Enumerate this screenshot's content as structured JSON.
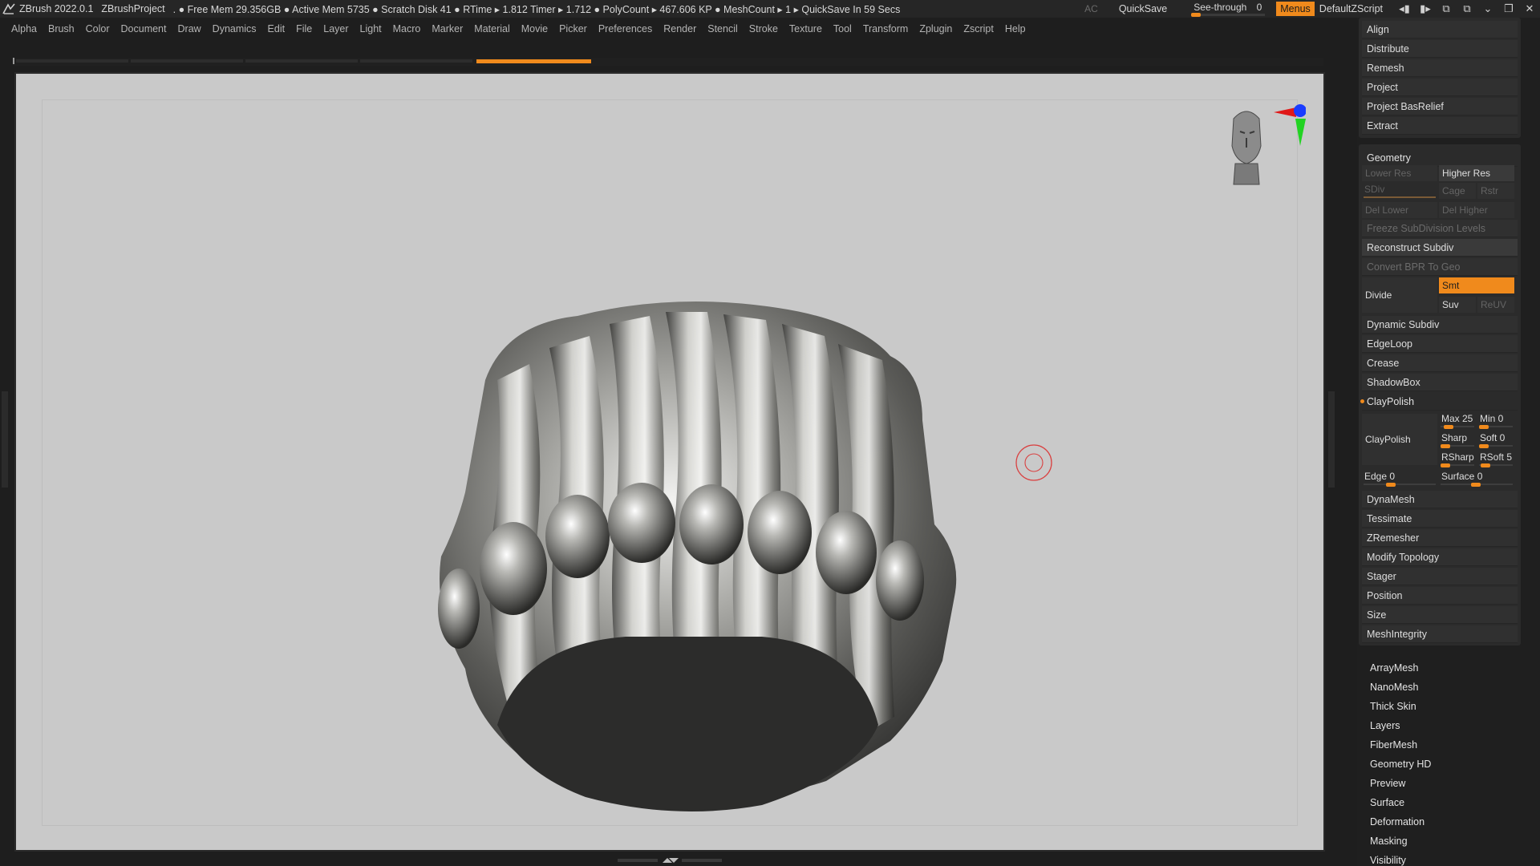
{
  "titlebar": {
    "app": "ZBrush 2022.0.1",
    "project": "ZBrushProject",
    "stats": ". ● Free Mem 29.356GB ● Active Mem 5735 ● Scratch Disk 41 ● RTime ▸ 1.812 Timer ▸ 1.712 ● PolyCount ▸ 467.606 KP ● MeshCount ▸ 1 ▸ QuickSave In 59 Secs",
    "ac": "AC",
    "quicksave": "QuickSave",
    "seethrough_label": "See-through",
    "seethrough_value": "0",
    "menus": "Menus",
    "script": "DefaultZScript"
  },
  "menubar": [
    "Alpha",
    "Brush",
    "Color",
    "Document",
    "Draw",
    "Dynamics",
    "Edit",
    "File",
    "Layer",
    "Light",
    "Macro",
    "Marker",
    "Material",
    "Movie",
    "Picker",
    "Preferences",
    "Render",
    "Stencil",
    "Stroke",
    "Texture",
    "Tool",
    "Transform",
    "Zplugin",
    "Zscript",
    "Help"
  ],
  "palette": {
    "top_items": [
      "Align",
      "Distribute",
      "Remesh",
      "Project",
      "Project BasRelief",
      "Extract"
    ],
    "geometry": {
      "title": "Geometry",
      "lower_res": "Lower Res",
      "higher_res": "Higher Res",
      "sdiv": "SDiv",
      "cage": "Cage",
      "rstr": "Rstr",
      "del_lower": "Del Lower",
      "del_higher": "Del Higher",
      "freeze": "Freeze SubDivision Levels",
      "reconstruct": "Reconstruct Subdiv",
      "convert_bpr": "Convert BPR To Geo",
      "divide": "Divide",
      "smt": "Smt",
      "suv": "Suv",
      "reuv": "ReUV",
      "dynamic_subdiv": "Dynamic Subdiv",
      "edgeloop": "EdgeLoop",
      "crease": "Crease",
      "shadowbox": "ShadowBox",
      "claypolish_header": "ClayPolish",
      "claypolish_btn": "ClayPolish",
      "max": "Max 25",
      "min": "Min 0",
      "sharp": "Sharp",
      "soft": "Soft 0",
      "rsharp": "RSharp",
      "rsoft": "RSoft 5",
      "edge": "Edge 0",
      "surface": "Surface 0",
      "after": [
        "DynaMesh",
        "Tessimate",
        "ZRemesher",
        "Modify Topology",
        "Stager",
        "Position",
        "Size",
        "MeshIntegrity"
      ]
    },
    "subpalettes": [
      "ArrayMesh",
      "NanoMesh",
      "Thick Skin",
      "Layers",
      "FiberMesh",
      "Geometry HD",
      "Preview",
      "Surface",
      "Deformation",
      "Masking",
      "Visibility"
    ]
  },
  "icons": {
    "logo": "zbrush-logo-icon",
    "head": "navigation-head-icon",
    "cursor": "brush-cursor-icon"
  },
  "colors": {
    "accent": "#f08a1c",
    "viewport_bg": "#c9c9c9",
    "panel": "#2b2b2b"
  }
}
